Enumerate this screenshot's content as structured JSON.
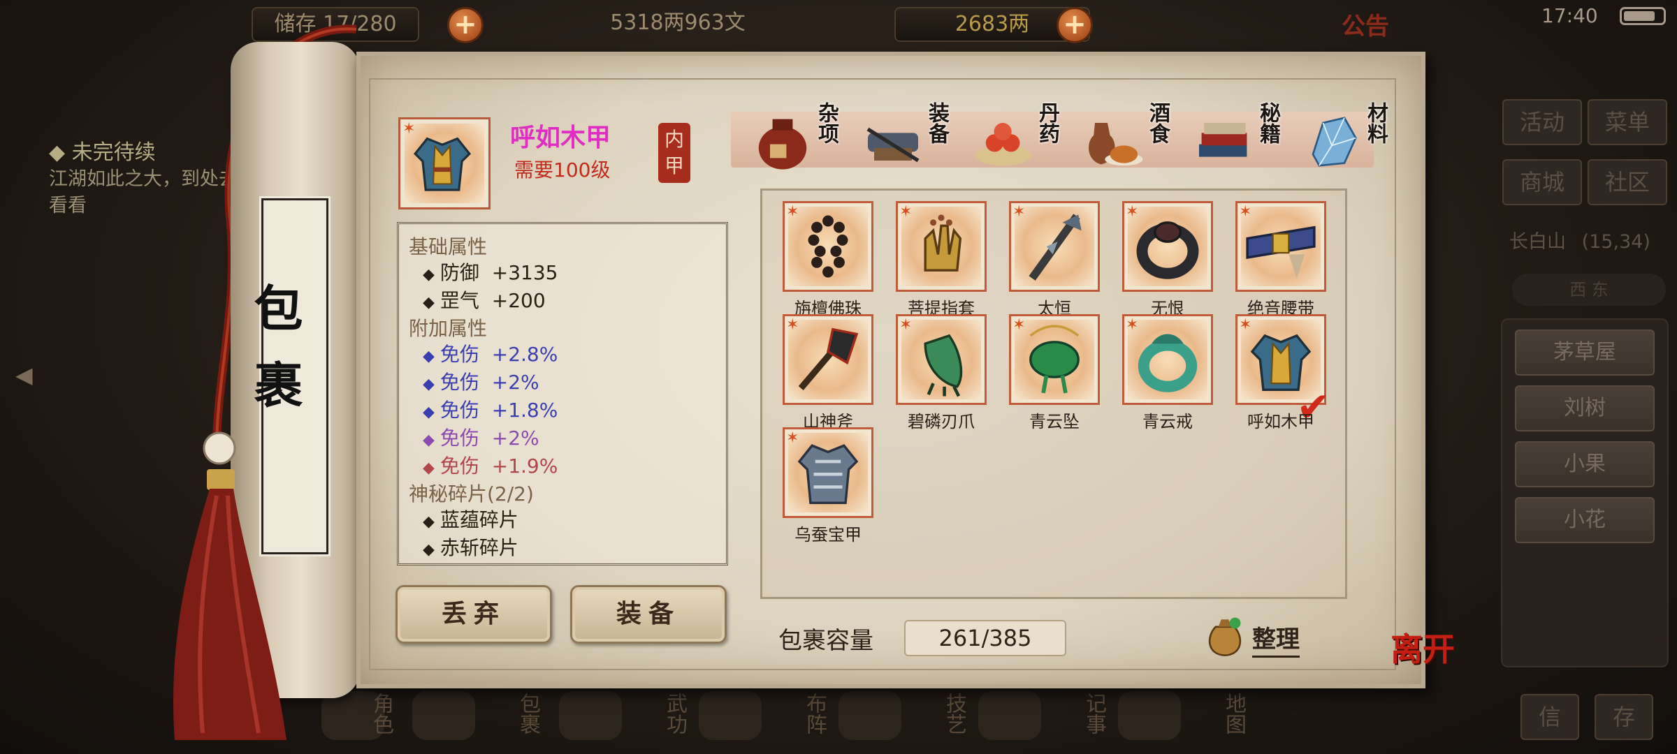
{
  "top_bar": {
    "bag_label": "储存",
    "bag_count": "17/280",
    "silver": "5318两963文",
    "gold": "2683两",
    "announcement": "公告",
    "time": "17:40"
  },
  "quest": {
    "title": "未完待续",
    "text": "江湖如此之大，到处去看看"
  },
  "right_menu": {
    "buttons": [
      "活动",
      "菜单",
      "商城",
      "社区"
    ],
    "location": "长白山",
    "coords": "(15,34)",
    "compass": "西 东",
    "npcs": [
      "茅草屋",
      "刘树",
      "小果",
      "小花"
    ],
    "bottom_buttons": [
      "信",
      "存"
    ]
  },
  "bottom_nav": [
    "角色",
    "包裹",
    "武功",
    "布阵",
    "技艺",
    "记事",
    "地图"
  ],
  "scroll": {
    "title": "包裹"
  },
  "selected_item": {
    "name": "呼如木甲",
    "level_req": "需要100级",
    "slot": "内甲",
    "base_header": "基础属性",
    "base_attrs": [
      {
        "label": "防御",
        "value": "+3135"
      },
      {
        "label": "罡气",
        "value": "+200"
      }
    ],
    "extra_header": "附加属性",
    "extra_attrs": [
      {
        "label": "免伤",
        "value": "+2.8%",
        "color": "#3a3fb0"
      },
      {
        "label": "免伤",
        "value": "+2%",
        "color": "#3a3fb0"
      },
      {
        "label": "免伤",
        "value": "+1.8%",
        "color": "#3a3fb0"
      },
      {
        "label": "免伤",
        "value": "+2%",
        "color": "#8a4bb0"
      },
      {
        "label": "免伤",
        "value": "+1.9%",
        "color": "#b0464a"
      }
    ],
    "shard_header": "神秘碎片(2/2)",
    "shards": [
      "蓝蕴碎片",
      "赤斩碎片"
    ]
  },
  "actions": {
    "discard": "丢弃",
    "equip": "装备"
  },
  "categories": [
    {
      "label": "杂项",
      "icon": "jar-icon"
    },
    {
      "label": "装备",
      "icon": "gear-bundle-icon"
    },
    {
      "label": "丹药",
      "icon": "pills-icon"
    },
    {
      "label": "酒食",
      "icon": "wine-food-icon"
    },
    {
      "label": "秘籍",
      "icon": "books-icon"
    },
    {
      "label": "材料",
      "icon": "crystal-icon"
    }
  ],
  "items": [
    {
      "name": "旃檀佛珠",
      "icon": "prayer-beads-icon"
    },
    {
      "name": "菩提指套",
      "icon": "finger-guard-icon"
    },
    {
      "name": "太恒",
      "icon": "staff-icon"
    },
    {
      "name": "无恨",
      "icon": "dark-ring-icon"
    },
    {
      "name": "绝音腰带",
      "icon": "belt-icon"
    },
    {
      "name": "山神斧",
      "icon": "axe-icon"
    },
    {
      "name": "碧磷刃爪",
      "icon": "claw-icon"
    },
    {
      "name": "青云坠",
      "icon": "pendant-icon"
    },
    {
      "name": "青云戒",
      "icon": "jade-ring-icon"
    },
    {
      "name": "呼如木甲",
      "icon": "armor-icon",
      "selected": true
    },
    {
      "name": "乌蚕宝甲",
      "icon": "silver-armor-icon"
    }
  ],
  "capacity": {
    "label": "包裹容量",
    "value": "261/385"
  },
  "sort_label": "整理",
  "leave_label": "离开"
}
